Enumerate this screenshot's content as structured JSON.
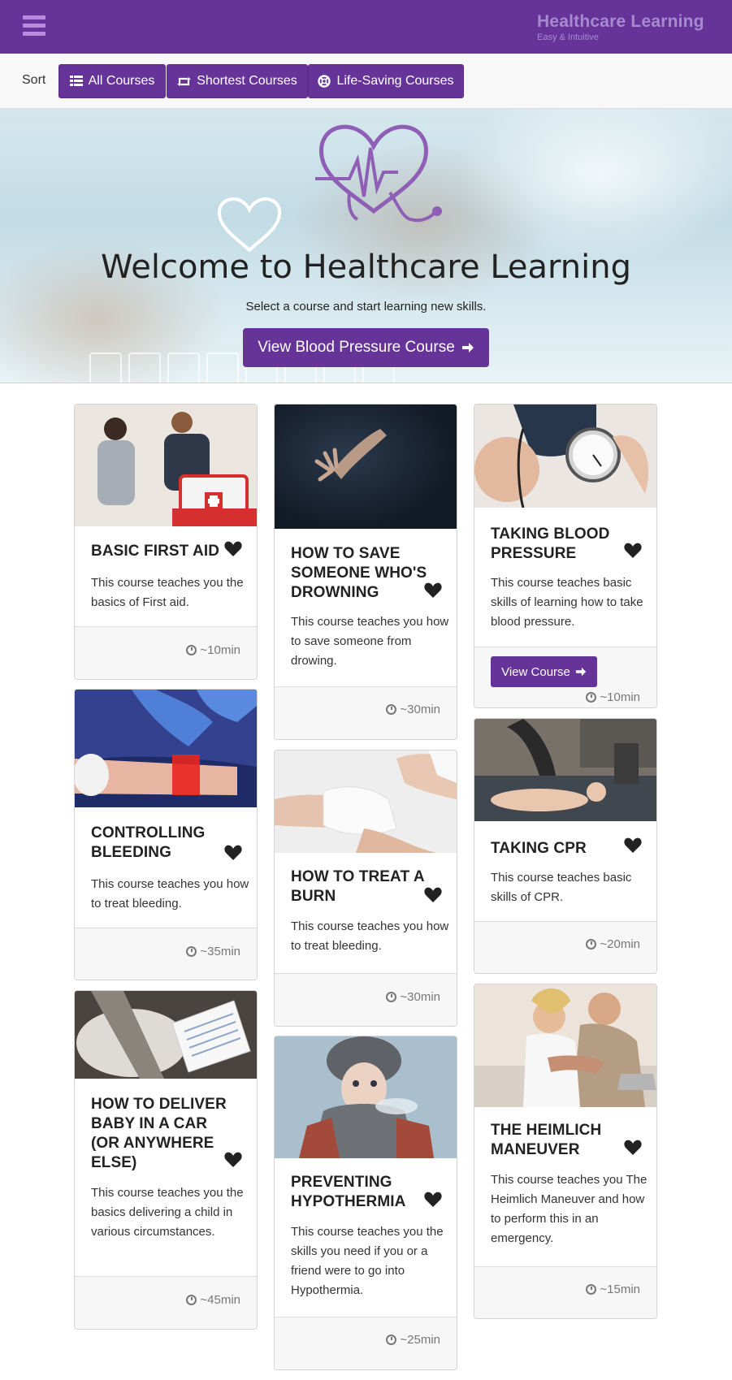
{
  "navbar": {
    "brand_title": "Healthcare Learning",
    "brand_subtitle": "Easy & Intuitive",
    "menu_icon": "hamburger-icon"
  },
  "sortbar": {
    "label": "Sort",
    "buttons": [
      {
        "label": "All Courses",
        "icon": "list-icon"
      },
      {
        "label": "Shortest Courses",
        "icon": "retweet-icon"
      },
      {
        "label": "Life-Saving Courses",
        "icon": "life-ring-icon"
      }
    ]
  },
  "hero": {
    "title": "Welcome to Healthcare Learning",
    "subtitle": "Select a course and start learning new skills.",
    "button_label": "View Blood Pressure Course"
  },
  "courses": [
    {
      "title": "Basic First Aid",
      "description": "This course teaches you the basics of First aid.",
      "duration": "~10min"
    },
    {
      "title": "How to save someone who's drowning",
      "description": "This course teaches you how to save someone from drowing.",
      "duration": "~30min"
    },
    {
      "title": "Taking Blood Pressure",
      "description": "This course teaches basic skills of learning how to take blood pressure.",
      "duration": "~10min",
      "button_label": "View Course"
    },
    {
      "title": "Controlling Bleeding",
      "description": "This course teaches you how to treat bleeding.",
      "duration": "~35min"
    },
    {
      "title": "How to treat a burn",
      "description": "This course teaches you how to treat bleeding.",
      "duration": "~30min"
    },
    {
      "title": "Taking CPR",
      "description": "This course teaches basic skills of CPR.",
      "duration": "~20min"
    },
    {
      "title": "How to deliver baby in a car (or anywhere else)",
      "description": "This course teaches you the basics delivering a child in various circumstances.",
      "duration": "~45min"
    },
    {
      "title": "Preventing Hypothermia",
      "description": "This course teaches you the skills you need if you or a friend were to go into Hypothermia.",
      "duration": "~25min"
    },
    {
      "title": "The Heimlich Maneuver",
      "description": "This course teaches you The Heimlich Maneuver and how to perform this in an emergency.",
      "duration": "~15min"
    }
  ],
  "colors": {
    "brand": "#663399",
    "brand_text": "#a78bd0"
  }
}
